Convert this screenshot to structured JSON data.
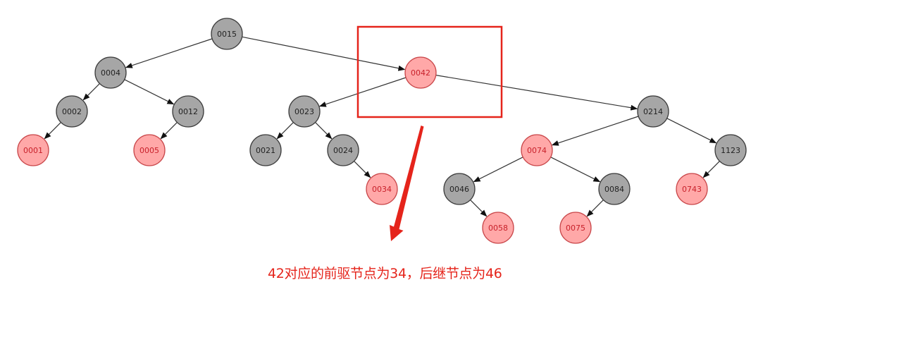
{
  "nodes": [
    {
      "id": "n0015",
      "label": "0015",
      "color": "black"
    },
    {
      "id": "n0004",
      "label": "0004",
      "color": "black"
    },
    {
      "id": "n0042",
      "label": "0042",
      "color": "red"
    },
    {
      "id": "n0002",
      "label": "0002",
      "color": "black"
    },
    {
      "id": "n0012",
      "label": "0012",
      "color": "black"
    },
    {
      "id": "n0023",
      "label": "0023",
      "color": "black"
    },
    {
      "id": "n0214",
      "label": "0214",
      "color": "black"
    },
    {
      "id": "n0001",
      "label": "0001",
      "color": "red"
    },
    {
      "id": "n0005",
      "label": "0005",
      "color": "red"
    },
    {
      "id": "n0021",
      "label": "0021",
      "color": "black"
    },
    {
      "id": "n0024",
      "label": "0024",
      "color": "black"
    },
    {
      "id": "n0074",
      "label": "0074",
      "color": "red"
    },
    {
      "id": "n1123",
      "label": "1123",
      "color": "black"
    },
    {
      "id": "n0034",
      "label": "0034",
      "color": "red"
    },
    {
      "id": "n0046",
      "label": "0046",
      "color": "black"
    },
    {
      "id": "n0084",
      "label": "0084",
      "color": "black"
    },
    {
      "id": "n0743",
      "label": "0743",
      "color": "red"
    },
    {
      "id": "n0058",
      "label": "0058",
      "color": "red"
    },
    {
      "id": "n0075",
      "label": "0075",
      "color": "red"
    }
  ],
  "edges": [
    {
      "from": "n0015",
      "to": "n0004"
    },
    {
      "from": "n0015",
      "to": "n0042"
    },
    {
      "from": "n0004",
      "to": "n0002"
    },
    {
      "from": "n0004",
      "to": "n0012"
    },
    {
      "from": "n0042",
      "to": "n0023"
    },
    {
      "from": "n0042",
      "to": "n0214"
    },
    {
      "from": "n0002",
      "to": "n0001"
    },
    {
      "from": "n0012",
      "to": "n0005"
    },
    {
      "from": "n0023",
      "to": "n0021"
    },
    {
      "from": "n0023",
      "to": "n0024"
    },
    {
      "from": "n0024",
      "to": "n0034"
    },
    {
      "from": "n0214",
      "to": "n0074"
    },
    {
      "from": "n0214",
      "to": "n1123"
    },
    {
      "from": "n0074",
      "to": "n0046"
    },
    {
      "from": "n0074",
      "to": "n0084"
    },
    {
      "from": "n0046",
      "to": "n0058"
    },
    {
      "from": "n0084",
      "to": "n0075"
    },
    {
      "from": "n1123",
      "to": "n0743"
    }
  ],
  "colors": {
    "black_node_fill": "#a6a6a6",
    "black_node_stroke": "#3c3c3c",
    "red_node_fill": "#ffa8a8",
    "red_node_stroke": "#c9474a",
    "black_node_text": "#222222",
    "red_node_text": "#c8202a",
    "edge": "#333333",
    "highlight": "#e5241b"
  },
  "annotation": {
    "text": "42对应的前驱节点为34，后继节点为46"
  }
}
